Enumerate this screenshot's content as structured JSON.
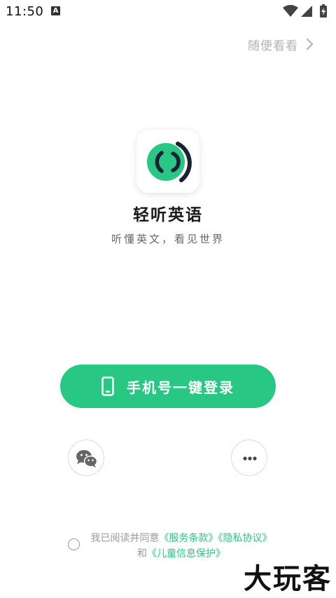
{
  "status_bar": {
    "time": "11:50",
    "notification_letter": "A",
    "icons": [
      "wifi-icon",
      "signal-icon",
      "battery-icon"
    ]
  },
  "header": {
    "skip_label": "随便看看"
  },
  "app": {
    "name": "轻听英语",
    "slogan": "听懂英文，看见世界",
    "logo_color": "#28c884",
    "logo_arc_color": "#1a2233"
  },
  "login": {
    "phone_button_label": "手机号一键登录",
    "accent_color": "#28c884",
    "alternatives": [
      {
        "name": "wechat",
        "icon": "wechat-icon"
      },
      {
        "name": "more",
        "icon": "more-dots-icon"
      }
    ]
  },
  "agreement": {
    "prefix": "我已阅读并同意",
    "service_terms": "《服务条款》",
    "privacy_policy": "《隐私协议》",
    "conjunction": "和",
    "child_protection": "《儿童信息保护》"
  },
  "watermark": {
    "text": "大玩客"
  }
}
